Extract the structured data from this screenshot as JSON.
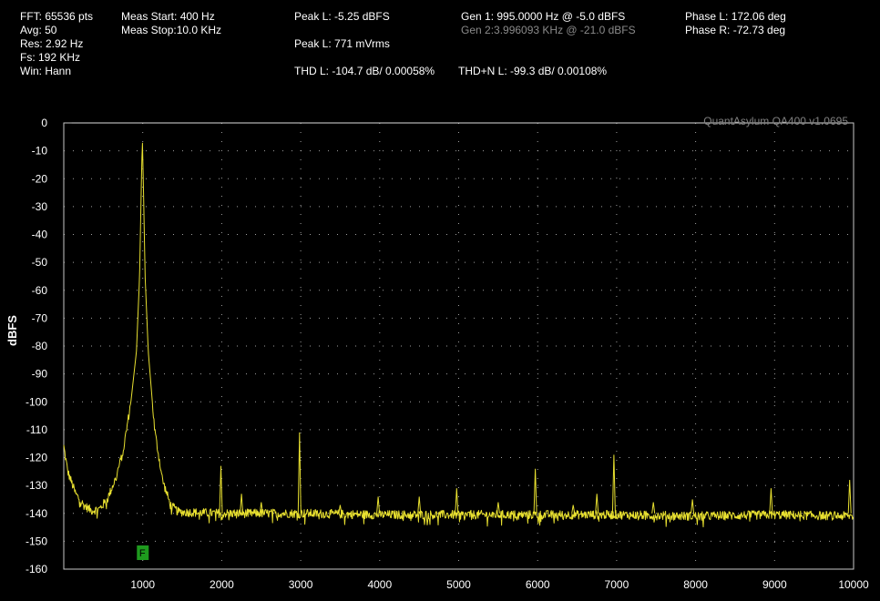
{
  "header": {
    "fft": "FFT: 65536 pts",
    "avg": "Avg: 50",
    "res": "Res: 2.92 Hz",
    "fs": "Fs: 192 KHz",
    "win": "Win: Hann",
    "meas_start": "Meas Start: 400 Hz",
    "meas_stop": "Meas Stop:10.0 KHz",
    "peak_l_dbfs": "Peak L: -5.25 dBFS",
    "peak_l_mvrms": "Peak L: 771 mVrms",
    "thd_l": "THD L: -104.7 dB/ 0.00058%",
    "thdn_l": "THD+N L: -99.3 dB/ 0.00108%",
    "gen1": "Gen 1: 995.0000 Hz @ -5.0  dBFS",
    "gen2": "Gen 2:3.996093 KHz @ -21.0  dBFS",
    "phase_l": "Phase L: 172.06 deg",
    "phase_r": "Phase R: -72.73 deg"
  },
  "watermark": "QuantAsylum QA400 v1.0695",
  "marker_label": "F",
  "colors": {
    "trace": "#e8e030",
    "marker": "#1e9a1e",
    "grid": "#c8c8c8"
  },
  "chart_data": {
    "type": "line",
    "xlabel": "",
    "ylabel": "dBFS",
    "xlim": [
      0,
      10000
    ],
    "ylim": [
      -160,
      0
    ],
    "xticks": [
      1000,
      2000,
      3000,
      4000,
      5000,
      6000,
      7000,
      8000,
      9000,
      10000
    ],
    "yticks": [
      0,
      -10,
      -20,
      -30,
      -40,
      -50,
      -60,
      -70,
      -80,
      -90,
      -100,
      -110,
      -120,
      -130,
      -140,
      -150,
      -160
    ],
    "grid": true,
    "marker_freq": 995,
    "series": [
      {
        "x": [
          0,
          50,
          150,
          250,
          350,
          450,
          550,
          650,
          750,
          850,
          920,
          960,
          980,
          995,
          1010,
          1030,
          1070,
          1150,
          1250,
          1350,
          1450,
          2000,
          2500,
          3000,
          4000,
          5000,
          6000,
          7000,
          8000,
          9000,
          10000
        ],
        "y": [
          -116,
          -125,
          -133,
          -137,
          -139,
          -138.5,
          -135,
          -128,
          -118,
          -100,
          -82,
          -55,
          -25,
          -5.25,
          -25,
          -55,
          -82,
          -110,
          -128,
          -137,
          -139.5,
          -140,
          -140,
          -140,
          -140.5,
          -140.5,
          -140.5,
          -140.5,
          -141,
          -140.5,
          -141
        ],
        "peaks": [
          {
            "x": 1990,
            "y": -123
          },
          {
            "x": 2250,
            "y": -133
          },
          {
            "x": 2500,
            "y": -136
          },
          {
            "x": 2985,
            "y": -111
          },
          {
            "x": 3500,
            "y": -137
          },
          {
            "x": 3980,
            "y": -134
          },
          {
            "x": 4500,
            "y": -134
          },
          {
            "x": 4975,
            "y": -131
          },
          {
            "x": 5500,
            "y": -136
          },
          {
            "x": 5970,
            "y": -124
          },
          {
            "x": 6450,
            "y": -137
          },
          {
            "x": 6750,
            "y": -133
          },
          {
            "x": 6965,
            "y": -119
          },
          {
            "x": 7465,
            "y": -136
          },
          {
            "x": 7960,
            "y": -135
          },
          {
            "x": 8955,
            "y": -131
          },
          {
            "x": 9950,
            "y": -128
          }
        ]
      }
    ]
  }
}
